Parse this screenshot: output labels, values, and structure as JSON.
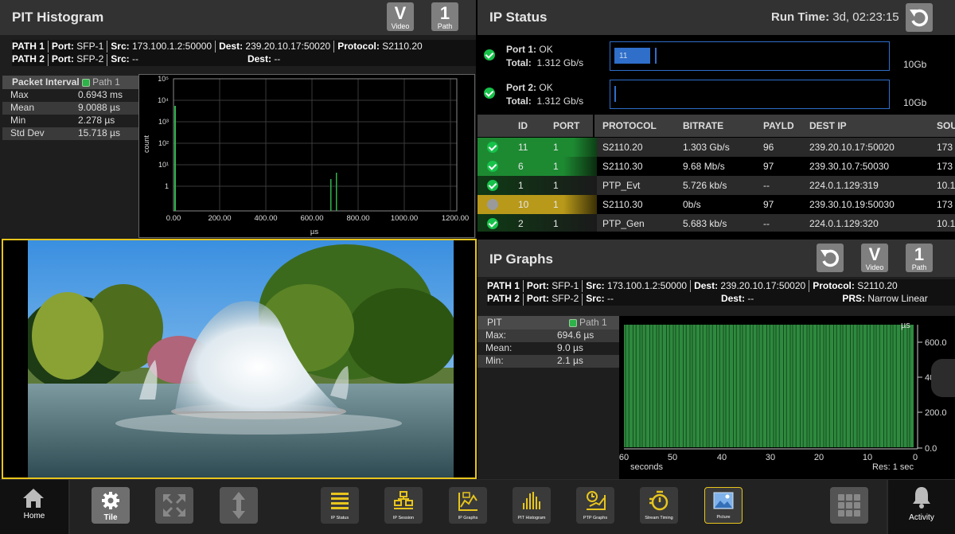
{
  "pit_histogram": {
    "title": "PIT Histogram",
    "video_btn": {
      "big": "V",
      "small": "Video"
    },
    "path_btn": {
      "big": "1",
      "small": "Path"
    },
    "path1": {
      "label": "PATH 1",
      "port_l": "Port:",
      "port": "SFP-1",
      "src_l": "Src:",
      "src": "173.100.1.2:50000",
      "dest_l": "Dest:",
      "dest": "239.20.10.17:50020",
      "proto_l": "Protocol:",
      "proto": "S2110.20"
    },
    "path2": {
      "label": "PATH 2",
      "port_l": "Port:",
      "port": "SFP-2",
      "src_l": "Src:",
      "src": "--",
      "dest_l": "Dest:",
      "dest": "--"
    },
    "stats_header": "Packet Interval",
    "legend": "Path 1",
    "stats": [
      {
        "k": "Max",
        "v": "0.6943 ms"
      },
      {
        "k": "Mean",
        "v": "9.0088 µs"
      },
      {
        "k": "Min",
        "v": "2.278 µs"
      },
      {
        "k": "Std Dev",
        "v": "15.718 µs"
      }
    ],
    "ylabel": "count",
    "xlabel": "µs",
    "y_ticks": [
      "10⁵",
      "10⁴",
      "10³",
      "10²",
      "10¹",
      "1"
    ],
    "x_ticks": [
      "0.00",
      "200.00",
      "400.00",
      "600.00",
      "800.00",
      "1000.00",
      "1200.00"
    ]
  },
  "ip_status": {
    "title": "IP Status",
    "runtime_label": "Run Time:",
    "runtime": "3d, 02:23:15",
    "port1": {
      "name": "Port 1:",
      "status": "OK",
      "total_l": "Total:",
      "total": "1.312 Gb/s",
      "bar_label": "11",
      "scale": "10Gb"
    },
    "port2": {
      "name": "Port 2:",
      "status": "OK",
      "total_l": "Total:",
      "total": "1.312 Gb/s",
      "scale": "10Gb"
    },
    "columns": [
      "ID",
      "PORT",
      "PROTOCOL",
      "BITRATE",
      "PAYLD",
      "DEST IP",
      "SOU"
    ],
    "rows": [
      {
        "id": "11",
        "port": "1",
        "protocol": "S2110.20",
        "bitrate": "1.303 Gb/s",
        "payld": "96",
        "dest": "239.20.10.17:50020",
        "src": "173"
      },
      {
        "id": "6",
        "port": "1",
        "protocol": "S2110.30",
        "bitrate": "9.68 Mb/s",
        "payld": "97",
        "dest": "239.30.10.7:50030",
        "src": "173"
      },
      {
        "id": "1",
        "port": "1",
        "protocol": "PTP_Evt",
        "bitrate": "5.726 kb/s",
        "payld": "--",
        "dest": "224.0.1.129:319",
        "src": "10.1"
      },
      {
        "id": "10",
        "port": "1",
        "protocol": "S2110.30",
        "bitrate": "0b/s",
        "payld": "97",
        "dest": "239.30.10.19:50030",
        "src": "173"
      },
      {
        "id": "2",
        "port": "1",
        "protocol": "PTP_Gen",
        "bitrate": "5.683 kb/s",
        "payld": "--",
        "dest": "224.0.1.129:320",
        "src": "10.1"
      }
    ]
  },
  "ip_graphs": {
    "title": "IP Graphs",
    "video_btn": {
      "big": "V",
      "small": "Video"
    },
    "path_btn": {
      "big": "1",
      "small": "Path"
    },
    "path1": {
      "label": "PATH 1",
      "port_l": "Port:",
      "port": "SFP-1",
      "src_l": "Src:",
      "src": "173.100.1.2:50000",
      "dest_l": "Dest:",
      "dest": "239.20.10.17:50020",
      "proto_l": "Protocol:",
      "proto": "S2110.20"
    },
    "path2": {
      "label": "PATH 2",
      "port_l": "Port:",
      "port": "SFP-2",
      "src_l": "Src:",
      "src": "--",
      "dest_l": "Dest:",
      "dest": "--",
      "prs_l": "PRS:",
      "prs": "Narrow Linear"
    },
    "stats_header": "PIT",
    "legend": "Path 1",
    "stats": [
      {
        "k": "Max:",
        "v": "694.6 µs"
      },
      {
        "k": "Mean:",
        "v": "9.0 µs"
      },
      {
        "k": "Min:",
        "v": "2.1 µs"
      }
    ],
    "unit": "µs",
    "y_ticks": [
      "600.0",
      "400.0",
      "200.0",
      "0.0"
    ],
    "x_ticks": [
      "60",
      "50",
      "40",
      "30",
      "20",
      "10",
      "0"
    ],
    "xlabel": "seconds",
    "resolution": "Res: 1 sec"
  },
  "toolbar": {
    "home": "Home",
    "tile": "Tile",
    "activity": "Activity",
    "apps": [
      "IP Status",
      "IP Session",
      "IP Graphs",
      "PIT Histogram",
      "PTP Graphs",
      "Stream Timing",
      "Picture"
    ]
  },
  "colors": {
    "accent": "#e8c51c",
    "ok": "#17c24a",
    "bar": "#2e8a3e",
    "panel": "#1e1e1e",
    "title_bar": "#323232"
  }
}
